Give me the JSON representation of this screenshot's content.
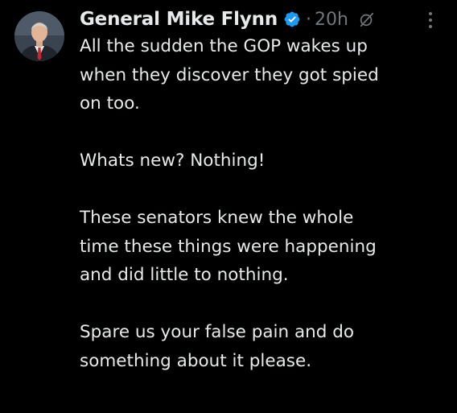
{
  "tweet": {
    "author": {
      "display_name": "General Mike Flynn",
      "verified_badge_icon": "verified-badge-icon",
      "verified_color": "#1d9bf0"
    },
    "separator": "·",
    "timestamp": "20h",
    "grok_icon": "grok-icon",
    "more_icon": "more-options-icon",
    "paragraphs": [
      {
        "lines": [
          "All the sudden the GOP wakes up",
          "when they discover they got spied",
          "on too."
        ]
      },
      {
        "lines": [
          "Whats new? Nothing!"
        ]
      },
      {
        "lines": [
          "These senators knew the whole",
          "time these things were happening",
          "and did little to nothing."
        ]
      },
      {
        "lines": [
          "Spare us your false pain and do",
          "something about it please."
        ]
      }
    ]
  },
  "colors": {
    "background": "#000000",
    "text": "#e7e9ea",
    "muted": "#71767b"
  }
}
